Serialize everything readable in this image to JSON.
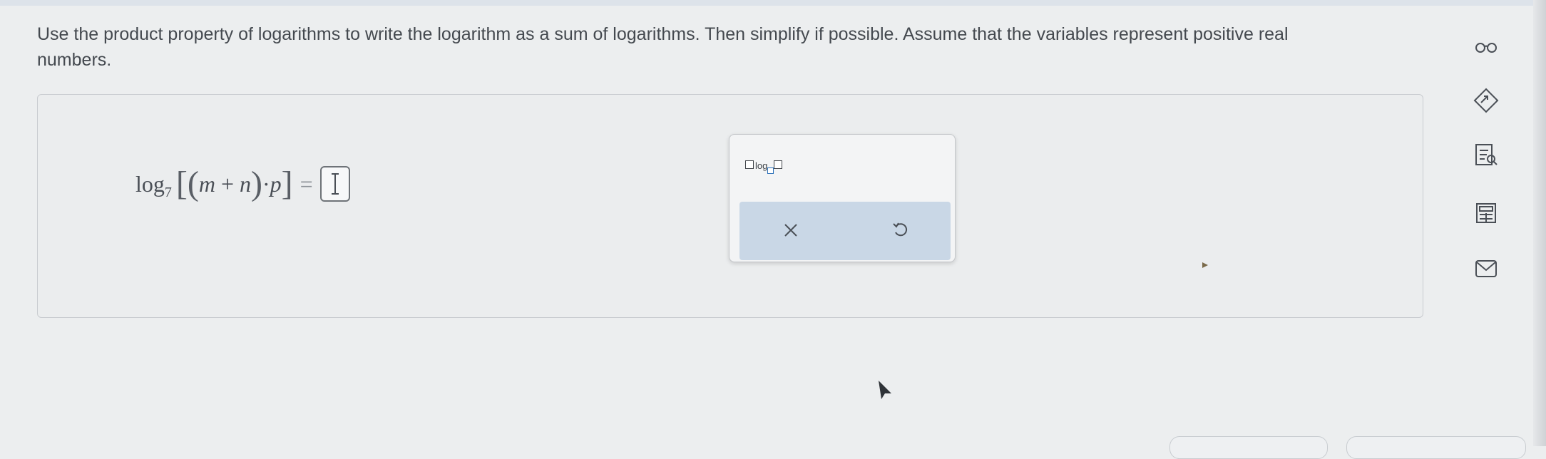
{
  "question": {
    "text": "Use the product property of logarithms to write the logarithm as a sum of logarithms. Then simplify if possible. Assume that the variables represent positive real numbers."
  },
  "expression": {
    "log": "log",
    "base": "7",
    "open_bracket": "[",
    "open_paren": "(",
    "m": "m",
    "plus": "+",
    "n": "n",
    "close_paren": ")",
    "dot": "·",
    "p": "p",
    "close_bracket": "]",
    "equals": "="
  },
  "answer": {
    "value": ""
  },
  "palette": {
    "template_label": "log",
    "clear_icon": "close-icon",
    "undo_icon": "undo-icon"
  },
  "sidebar_icons": [
    "glasses-icon",
    "link-icon",
    "notes-icon",
    "calculator-icon",
    "mail-icon"
  ],
  "colors": {
    "background": "#eceeef",
    "accent_blue": "#2a6fb8",
    "action_bar": "#c9d7e6"
  }
}
